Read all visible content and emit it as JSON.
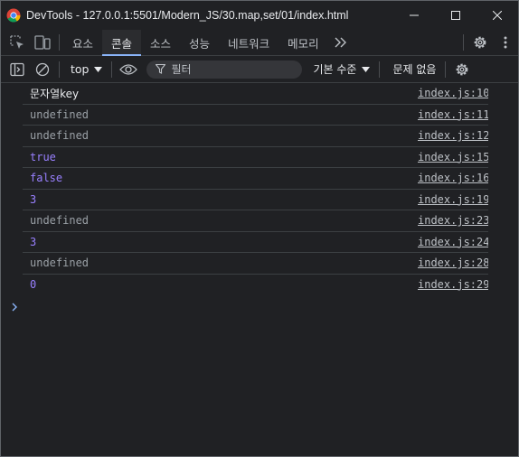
{
  "window": {
    "title": "DevTools - 127.0.0.1:5501/Modern_JS/30.map,set/01/index.html",
    "app_icon": "chrome-icon",
    "controls": [
      "minimize-icon",
      "maximize-icon",
      "close-icon"
    ]
  },
  "tabs": {
    "items": [
      {
        "label": "요소",
        "active": false
      },
      {
        "label": "콘솔",
        "active": true
      },
      {
        "label": "소스",
        "active": false
      },
      {
        "label": "성능",
        "active": false
      },
      {
        "label": "네트워크",
        "active": false
      },
      {
        "label": "메모리",
        "active": false
      }
    ],
    "left_icons": [
      "inspect-element-icon",
      "device-toolbar-icon"
    ],
    "right_icons": [
      "more-tabs-icon",
      "settings-icon",
      "more-options-icon"
    ]
  },
  "console_toolbar": {
    "context": "top",
    "filter_placeholder": "필터",
    "levels_label": "기본 수준",
    "issues_label": "문제 없음",
    "icons": [
      "sidebar-toggle-icon",
      "clear-console-icon",
      "chevron-down-icon",
      "eye-icon",
      "filter-icon",
      "settings-icon"
    ]
  },
  "messages": [
    {
      "value": "문자열key",
      "kind": "str",
      "source": "index.js:10"
    },
    {
      "value": "undefined",
      "kind": "undef",
      "source": "index.js:11"
    },
    {
      "value": "undefined",
      "kind": "undef",
      "source": "index.js:12"
    },
    {
      "value": "true",
      "kind": "bool",
      "source": "index.js:15"
    },
    {
      "value": "false",
      "kind": "bool",
      "source": "index.js:16"
    },
    {
      "value": "3",
      "kind": "num",
      "source": "index.js:19"
    },
    {
      "value": "undefined",
      "kind": "undef",
      "source": "index.js:23"
    },
    {
      "value": "3",
      "kind": "num",
      "source": "index.js:24"
    },
    {
      "value": "undefined",
      "kind": "undef",
      "source": "index.js:28"
    },
    {
      "value": "0",
      "kind": "num",
      "source": "index.js:29"
    }
  ],
  "colors": {
    "background": "#202124",
    "accent": "#8ab4f8",
    "value_purple": "#9980ff",
    "undefined_gray": "#9aa0a6"
  }
}
